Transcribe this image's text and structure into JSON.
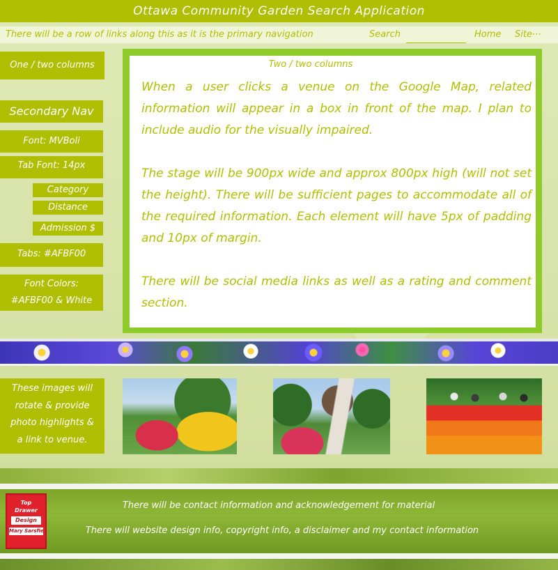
{
  "header": {
    "title": "Ottawa Community Garden Search Application"
  },
  "nav": {
    "note": "There will be a row of links along this as it is the primary navigation",
    "search_label": "Search",
    "home_label": "Home",
    "site_label": "Site⋯"
  },
  "sidebar": {
    "one_two_columns": "One / two columns",
    "secondary_nav": "Secondary Nav",
    "font": "Font: MVBoli",
    "tab_font": "Tab Font: 14px",
    "category": "Category",
    "distance": "Distance",
    "admission": "Admission $",
    "tabs": "Tabs: #AFBF00",
    "font_colors_line1": "Font Colors:",
    "font_colors_line2": "#AFBF00 & White"
  },
  "main": {
    "label": "Two / two columns",
    "paragraphs": [
      "When a user clicks a venue on the Google Map, related information will appear in a box in front of the map. I plan to include audio for the visually impaired.",
      "The stage will be 900px wide and approx 800px high (will not set the height). There will be sufficient pages to accommodate all of the required information. Each element will have 5px of padding and 10px of margin.",
      "There will be social media links as well as a rating and comment section."
    ]
  },
  "photos": {
    "caption_lines": [
      "These images will",
      "rotate & provide",
      "photo highlights &",
      "a link to venue."
    ],
    "items": [
      {
        "icon": "garden-photo-1"
      },
      {
        "icon": "garden-photo-2"
      },
      {
        "icon": "garden-photo-3"
      }
    ]
  },
  "footer": {
    "line1": "There will be contact information and acknowledgement for material",
    "line2": "There will website design info, copyright info, a disclaimer and my contact information",
    "logo": {
      "top": "Top",
      "drawer": "Drawer",
      "design": "Design",
      "name": "Mary Sarsfield"
    }
  },
  "colors": {
    "accent": "#AFBF00",
    "text_light": "#FFFFFF",
    "frame_green": "#8ECB2A"
  }
}
